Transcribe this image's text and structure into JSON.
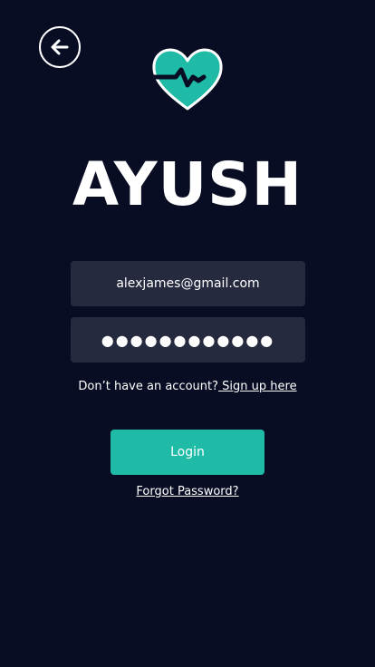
{
  "header": {
    "back_icon": "arrow-left-icon",
    "logo_icon": "heart-pulse-icon"
  },
  "app_title": "AYUSH",
  "form": {
    "email_value": "alexjames@gmail.com",
    "password_value": "●●●●●●●●●●●●",
    "signup_prompt": "Don’t have an account?",
    "signup_link": " Sign up here",
    "login_label": "Login",
    "forgot_label": "Forgot Password?"
  },
  "colors": {
    "background": "#080d24",
    "field_background": "#262a3f",
    "accent": "#1fbba6",
    "text": "#ffffff"
  }
}
